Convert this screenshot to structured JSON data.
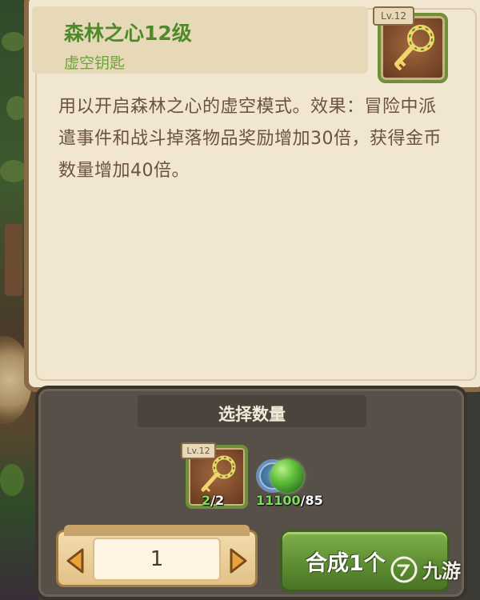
{
  "item": {
    "name": "森林之心12级",
    "type": "虚空钥匙",
    "level_badge": "Lv.12",
    "description": "用以开启森林之心的虚空模式。效果：冒险中派遣事件和战斗掉落物品奖励增加30倍，获得金币数量增加40倍。",
    "icon": "golden-key-icon"
  },
  "quantity": {
    "title": "选择数量",
    "value": "1"
  },
  "materials": [
    {
      "icon": "golden-key-icon",
      "level_badge": "Lv.12",
      "have": "2",
      "need": "/2"
    },
    {
      "icon": "green-orb-icon",
      "have": "11100",
      "need": "/85"
    }
  ],
  "craft_button": {
    "label": "合成1个"
  },
  "watermark": {
    "text": "九游",
    "icon": "9you-logo-icon"
  },
  "colors": {
    "panel_bg": "#f1e6cf",
    "item_name": "#4f8a2a",
    "description_text": "#6b5240",
    "craft_button": "#5e8e32",
    "material_have": "#7ee05a"
  }
}
